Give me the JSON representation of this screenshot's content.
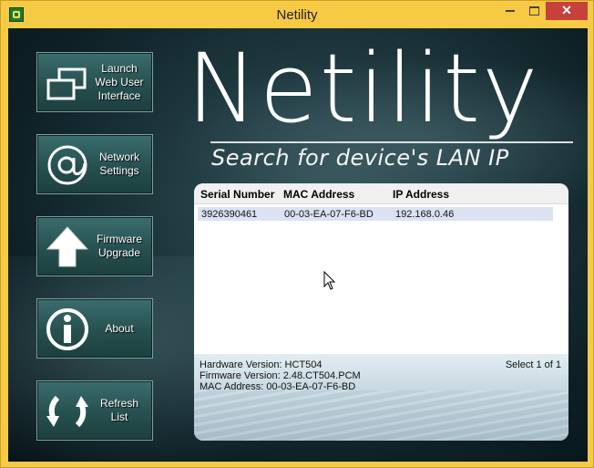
{
  "window": {
    "title": "Netility",
    "minimize_label": "—",
    "maximize_label": "☐",
    "close_label": "✕"
  },
  "sidebar": {
    "buttons": [
      {
        "label": "Launch\nWeb User\nInterface",
        "icon": "windows-icon"
      },
      {
        "label": "Network\nSettings",
        "icon": "at-sign-icon"
      },
      {
        "label": "Firmware\nUpgrade",
        "icon": "upload-arrow-icon"
      },
      {
        "label": "About",
        "icon": "info-icon"
      },
      {
        "label": "Refresh\nList",
        "icon": "refresh-icon"
      }
    ]
  },
  "logo": {
    "text": "Netility",
    "tagline": "Search for device's LAN IP"
  },
  "device_list": {
    "columns": [
      "Serial Number",
      "MAC Address",
      "IP Address"
    ],
    "rows": [
      {
        "serial": "3926390461",
        "mac": "00-03-EA-07-F6-BD",
        "ip": "192.168.0.46"
      }
    ]
  },
  "details": {
    "hardware": "Hardware Version: HCT504",
    "firmware": "Firmware Version: 2.48.CT504.PCM",
    "mac": "MAC Address: 00-03-EA-07-F6-BD",
    "selection": "Select 1 of 1"
  },
  "colors": {
    "title_bar": "#f6ca45",
    "close_button": "#c7413b",
    "row_selected": "#dbe2f2",
    "button_face": "#26504f"
  }
}
